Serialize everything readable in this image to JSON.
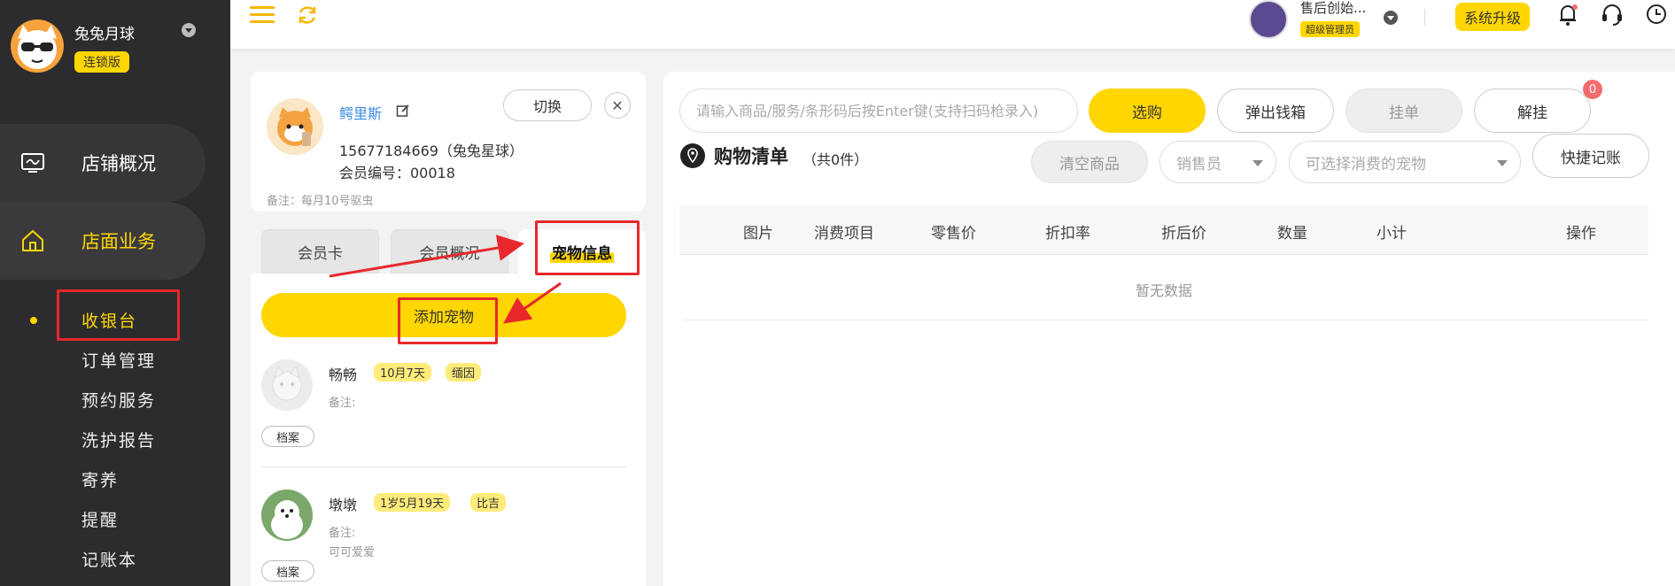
{
  "sidebar": {
    "brand_name": "兔兔月球",
    "brand_badge": "连锁版",
    "nav": [
      {
        "label": "店铺概况",
        "icon": "monitor-icon"
      },
      {
        "label": "店面业务",
        "icon": "home-icon"
      }
    ],
    "sub_items": [
      "收银台",
      "订单管理",
      "预约服务",
      "洗护报告",
      "寄养",
      "提醒",
      "记账本"
    ]
  },
  "header": {
    "user_name": "售后创始...",
    "user_role": "超级管理员",
    "upgrade_label": "系统升级",
    "icons": [
      "menu-icon",
      "refresh-icon",
      "bell-icon",
      "headset-icon",
      "clock-icon"
    ]
  },
  "member": {
    "name": "鳄里斯",
    "switch_label": "切换",
    "close_label": "✕",
    "phone": "15677184669（兔兔星球）",
    "member_no": "会员编号：00018",
    "note": "备注：每月10号驱虫"
  },
  "tabs": [
    "会员卡",
    "会员概况",
    "宠物信息"
  ],
  "pets": {
    "add_label": "添加宠物",
    "items": [
      {
        "name": "畅畅",
        "age": "10月7天",
        "breed": "缅因",
        "note_label": "备注:",
        "note": "",
        "file_label": "档案"
      },
      {
        "name": "墩墩",
        "age": "1岁5月19天",
        "breed": "比吉",
        "note_label": "备注:",
        "note": "可可爱爱",
        "file_label": "档案"
      }
    ]
  },
  "toolbar": {
    "search_placeholder": "请输入商品/服务/条形码后按Enter键(支持扫码枪录入)",
    "select_label": "选购",
    "cashbox_label": "弹出钱箱",
    "hold_label": "挂单",
    "unhold_label": "解挂",
    "unhold_count": "0"
  },
  "cart": {
    "title": "购物清单",
    "count": "（共0件）",
    "clear_label": "清空商品",
    "seller_placeholder": "销售员",
    "pet_placeholder": "可选择消费的宠物",
    "quick_label": "快捷记账",
    "columns": [
      "图片",
      "消费项目",
      "零售价",
      "折扣率",
      "折后价",
      "数量",
      "小计",
      "操作"
    ],
    "empty": "暂无数据"
  },
  "colors": {
    "accent": "#ffd600",
    "sidebar": "#2c2c2e",
    "annotation": "#e8282b",
    "link": "#3a8ee6"
  }
}
